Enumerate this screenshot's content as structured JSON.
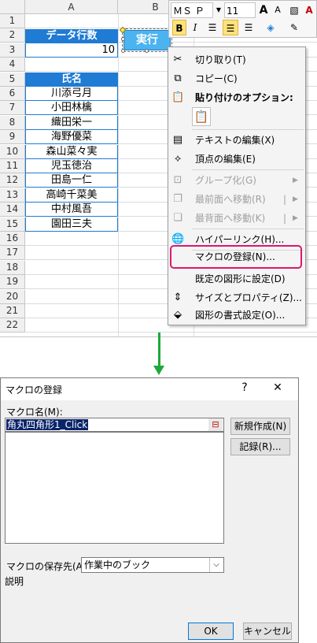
{
  "sheet": {
    "columns": [
      "A",
      "B"
    ],
    "rows": [
      "1",
      "2",
      "3",
      "4",
      "5",
      "6",
      "7",
      "8",
      "9",
      "10",
      "11",
      "12",
      "13",
      "14",
      "15",
      "16",
      "17",
      "18",
      "19",
      "20",
      "21",
      "22"
    ],
    "data_rows_header": "データ行数",
    "data_rows_value": "10",
    "name_header": "氏名",
    "names": [
      "川添弓月",
      "小田林檎",
      "織田栄一",
      "海野優菜",
      "森山菜々実",
      "児玉徳治",
      "田島一仁",
      "高崎千菜美",
      "中村風吾",
      "園田三夫"
    ],
    "run_button": "実行"
  },
  "mini_toolbar": {
    "font_name": "ＭＳ Ｐゴ",
    "font_size": "11",
    "bold": "B",
    "italic": "I"
  },
  "context_menu": {
    "cut": "切り取り(T)",
    "copy": "コピー(C)",
    "paste_options": "貼り付けのオプション:",
    "edit_text": "テキストの編集(X)",
    "edit_points": "頂点の編集(E)",
    "group": "グループ化(G)",
    "bring_front": "最前面へ移動(R)",
    "send_back": "最背面へ移動(K)",
    "hyperlink": "ハイパーリンク(H)...",
    "assign_macro": "マクロの登録(N)...",
    "set_default": "既定の図形に設定(D)",
    "size_props": "サイズとプロパティ(Z)...",
    "format_shape": "図形の書式設定(O)..."
  },
  "highlight_color": "#d9196f",
  "arrow_color": "#1ea83a",
  "dialog": {
    "title": "マクロの登録",
    "help": "?",
    "close": "✕",
    "macro_name_label": "マクロ名(M):",
    "macro_name_value": "角丸四角形1_Click",
    "new_button": "新規作成(N)",
    "record_button": "記録(R)...",
    "store_label": "マクロの保存先(A):",
    "store_value": "作業中のブック",
    "description_label": "説明",
    "ok": "OK",
    "cancel": "キャンセル"
  }
}
